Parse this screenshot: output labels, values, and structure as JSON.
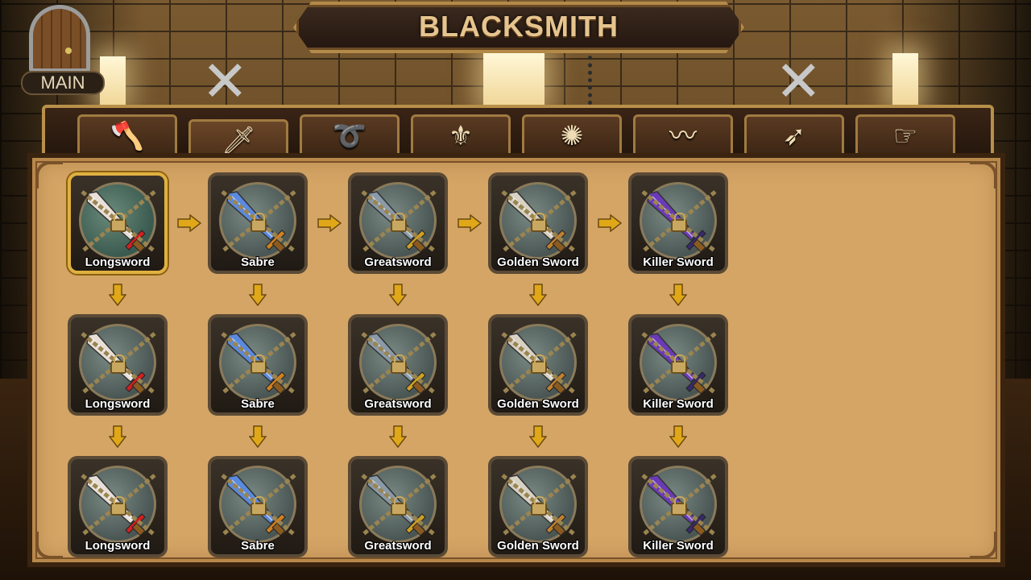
{
  "header": {
    "title": "BLACKSMITH"
  },
  "main_button": {
    "label": "MAIN"
  },
  "tabs": [
    {
      "name": "tab-axe",
      "icon": "axe-icon",
      "glyph": "🪓",
      "active": false
    },
    {
      "name": "tab-sword",
      "icon": "sword-icon",
      "glyph": "🗡",
      "active": true
    },
    {
      "name": "tab-whip",
      "icon": "whip-icon",
      "glyph": "➰",
      "active": false
    },
    {
      "name": "tab-spear",
      "icon": "spear-icon",
      "glyph": "⚜",
      "active": false
    },
    {
      "name": "tab-mace",
      "icon": "mace-icon",
      "glyph": "✺",
      "active": false
    },
    {
      "name": "tab-serpent-blade",
      "icon": "serpent-blade-icon",
      "glyph": "〰",
      "active": false
    },
    {
      "name": "tab-lance",
      "icon": "lance-icon",
      "glyph": "➶",
      "active": false
    },
    {
      "name": "tab-claw",
      "icon": "claw-icon",
      "glyph": "☞",
      "active": false
    }
  ],
  "items": {
    "rows": [
      [
        "Longsword",
        "Sabre",
        "Greatsword",
        "Golden Sword",
        "Killer Sword"
      ],
      [
        "Longsword",
        "Sabre",
        "Greatsword",
        "Golden Sword",
        "Killer Sword"
      ],
      [
        "Longsword",
        "Sabre",
        "Greatsword",
        "Golden Sword",
        "Killer Sword"
      ]
    ],
    "selected": [
      0,
      0
    ],
    "locked": true,
    "blade_colors": {
      "Longsword": "#e8e0d8",
      "Sabre": "#5a8ae0",
      "Greatsword": "#8a9aa8",
      "Golden Sword": "#d8d2c4",
      "Killer Sword": "#6a3ab8"
    },
    "accent_colors": {
      "Longsword": "#d02020",
      "Sabre": "#d08020",
      "Greatsword": "#d0a020",
      "Golden Sword": "#c08030",
      "Killer Sword": "#3a2a6a"
    }
  },
  "colors": {
    "panel": "#d5a566",
    "arrow": "#e0a818",
    "gold_border": "#b8904a"
  }
}
